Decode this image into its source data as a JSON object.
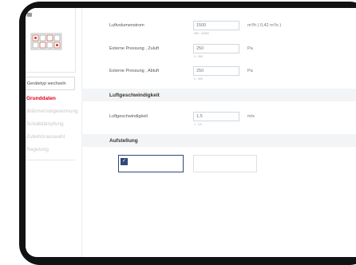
{
  "sidebar": {
    "switch_label": "Gerätetyp wechseln",
    "items": [
      {
        "label": "Grunddaten",
        "active": true
      },
      {
        "label": "Wärmerückgewinnung",
        "active": false
      },
      {
        "label": "Schalldämpfung",
        "active": false
      },
      {
        "label": "Zubehörauswahl",
        "active": false
      },
      {
        "label": "Regelung",
        "active": false
      }
    ]
  },
  "form": {
    "air_volume": {
      "label": "Luftvolumenstrom",
      "value": "1500",
      "hint": "300 - 10400",
      "unit": "m³/h ( 0,42 m³/s )"
    },
    "ext_pressure_supply": {
      "label": "Externe Pressung ,  Zuluft",
      "value": "250",
      "hint": "0 - 990",
      "unit": "Pa"
    },
    "ext_pressure_exhaust": {
      "label": "Externe Pressung ,  Abluft",
      "value": "250",
      "hint": "0 - 990",
      "unit": "Pa"
    },
    "air_speed_section": "Luftgeschwindigkeit",
    "air_speed": {
      "label": "Luftgeschwindigkeit",
      "value": "1,5",
      "hint": "1 - 3,5",
      "unit": "m/s"
    },
    "setup_section": "Aufstellung"
  },
  "colors": {
    "accent": "#e3001b",
    "navy": "#2e4a7d"
  }
}
